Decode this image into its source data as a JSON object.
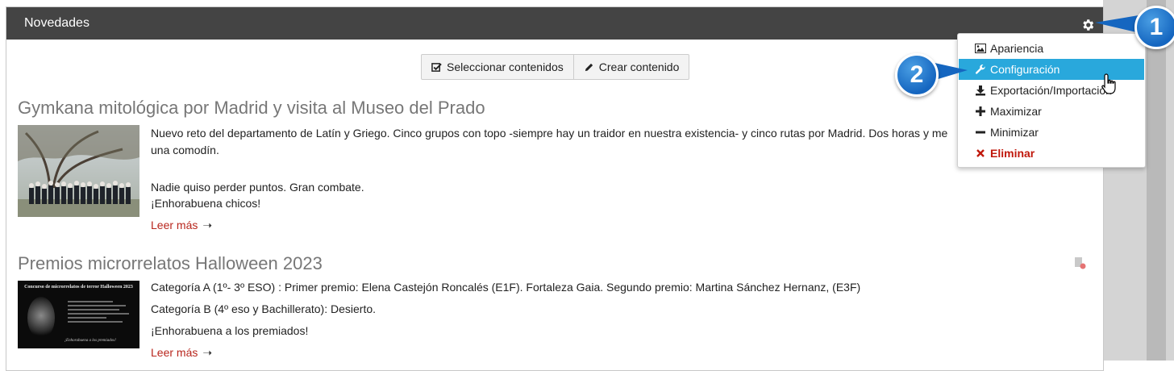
{
  "panel": {
    "title": "Novedades"
  },
  "toolbar": {
    "select_label": "Seleccionar contenidos",
    "create_label": "Crear contenido"
  },
  "articles": [
    {
      "title": "Gymkana mitológica por Madrid y visita al Museo del Prado",
      "paragraphs": [
        "Nuevo reto del departamento de Latín y Griego. Cinco grupos con topo -siempre hay un traidor en nuestra existencia- y cinco rutas por Madrid. Dos horas y me",
        "una comodín.",
        "Nadie quiso perder puntos. Gran combate.",
        "¡Enhorabuena chicos!"
      ],
      "read_more": "Leer más"
    },
    {
      "title": "Premios microrrelatos Halloween 2023",
      "thumbnail_text": {
        "heading": "Concurso de microrrelatos de terror Halloween 2023",
        "closing": "¡Enhorabuena a los premiados!"
      },
      "paragraphs": [
        "Categoría A (1º- 3º ESO) : Primer premio: Elena Castejón Roncalés (E1F). Fortaleza Gaia. Segundo premio: Martina Sánchez Hernanz, (E3F)",
        "Categoría B (4º eso y Bachillerato): Desierto.",
        "¡Enhorabuena a los premiados!"
      ],
      "read_more": "Leer más"
    }
  ],
  "menu": {
    "items": [
      {
        "label": "Apariencia",
        "icon": "image-icon"
      },
      {
        "label": "Configuración",
        "icon": "wrench-icon"
      },
      {
        "label": "Exportación/Importación",
        "icon": "download-icon"
      },
      {
        "label": "Maximizar",
        "icon": "plus-icon"
      },
      {
        "label": "Minimizar",
        "icon": "minus-icon"
      },
      {
        "label": "Eliminar",
        "icon": "x-icon"
      }
    ]
  },
  "callouts": {
    "first": "1",
    "second": "2"
  },
  "colors": {
    "header_bg": "#444444",
    "menu_active": "#29a8dc",
    "danger": "#c0180c",
    "link": "#b8261d",
    "badge": "#1566c0"
  }
}
